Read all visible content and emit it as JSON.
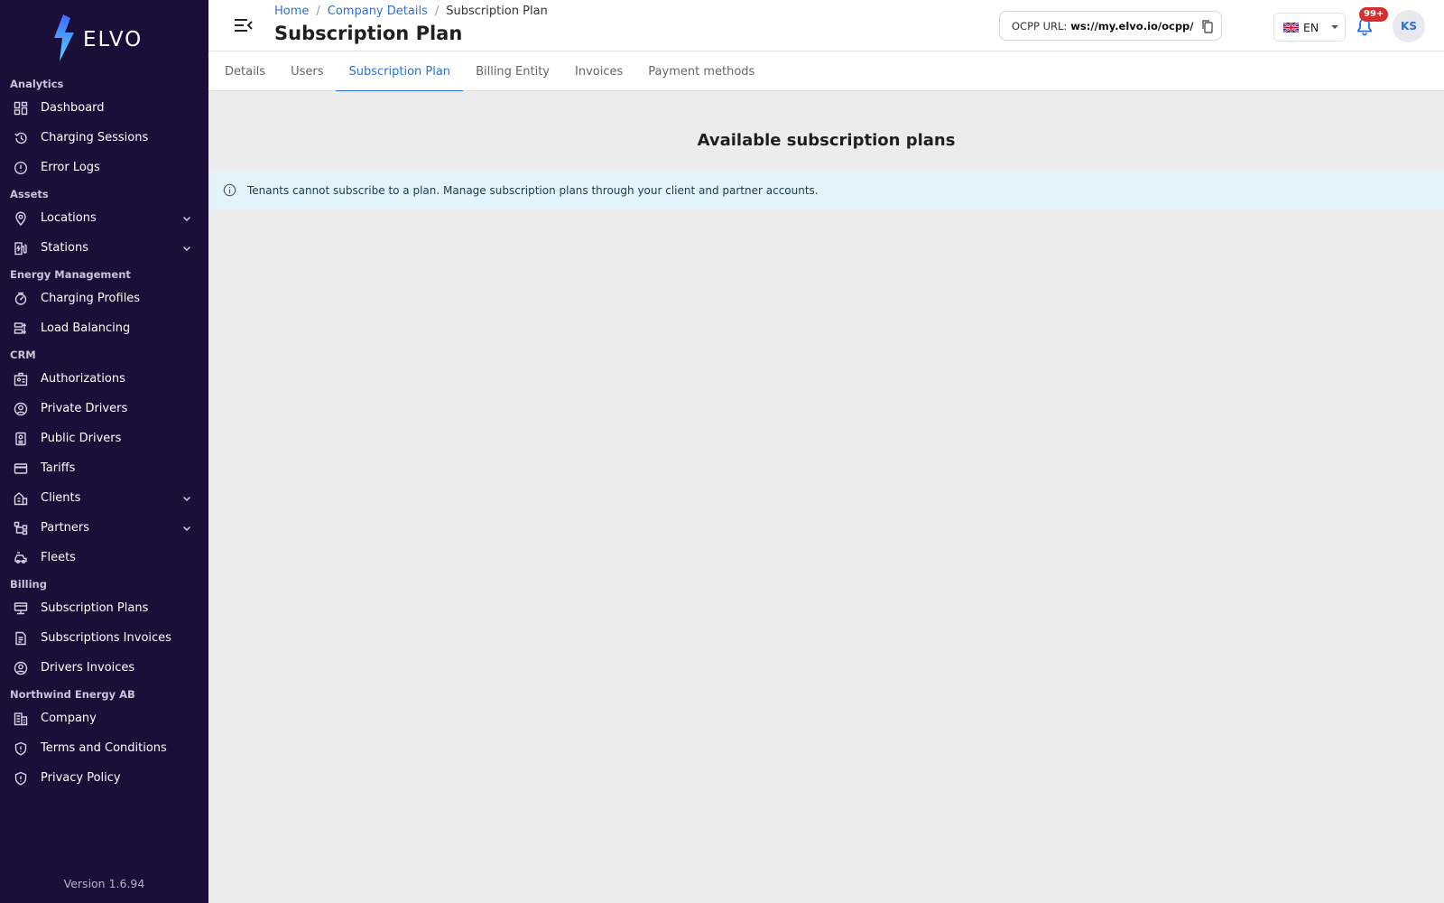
{
  "brand": {
    "name": "ELVO"
  },
  "sidebar": {
    "sections": [
      {
        "title": "Analytics",
        "items": [
          {
            "label": "Dashboard",
            "icon": "dashboard-icon",
            "expandable": false
          },
          {
            "label": "Charging Sessions",
            "icon": "history-icon",
            "expandable": false
          },
          {
            "label": "Error Logs",
            "icon": "error-icon",
            "expandable": false
          }
        ]
      },
      {
        "title": "Assets",
        "items": [
          {
            "label": "Locations",
            "icon": "location-pin-icon",
            "expandable": true
          },
          {
            "label": "Stations",
            "icon": "ev-station-icon",
            "expandable": true
          }
        ]
      },
      {
        "title": "Energy Management",
        "items": [
          {
            "label": "Charging Profiles",
            "icon": "profiles-icon",
            "expandable": false
          },
          {
            "label": "Load Balancing",
            "icon": "load-balancing-icon",
            "expandable": false
          }
        ]
      },
      {
        "title": "CRM",
        "items": [
          {
            "label": "Authorizations",
            "icon": "badge-icon",
            "expandable": false
          },
          {
            "label": "Private Drivers",
            "icon": "user-circle-icon",
            "expandable": false
          },
          {
            "label": "Public Drivers",
            "icon": "id-card-icon",
            "expandable": false
          },
          {
            "label": "Tariffs",
            "icon": "credit-card-icon",
            "expandable": false
          },
          {
            "label": "Clients",
            "icon": "building-icon",
            "expandable": true
          },
          {
            "label": "Partners",
            "icon": "hierarchy-icon",
            "expandable": true
          },
          {
            "label": "Fleets",
            "icon": "car-icon",
            "expandable": false
          }
        ]
      },
      {
        "title": "Billing",
        "items": [
          {
            "label": "Subscription Plans",
            "icon": "plans-icon",
            "expandable": false
          },
          {
            "label": "Subscriptions Invoices",
            "icon": "document-icon",
            "expandable": false
          },
          {
            "label": "Drivers Invoices",
            "icon": "user-circle-icon",
            "expandable": false
          }
        ]
      },
      {
        "title": "Northwind Energy AB",
        "items": [
          {
            "label": "Company",
            "icon": "company-icon",
            "expandable": false
          },
          {
            "label": "Terms and Conditions",
            "icon": "shield-icon",
            "expandable": false
          },
          {
            "label": "Privacy Policy",
            "icon": "shield-icon",
            "expandable": false
          }
        ]
      }
    ],
    "version": "Version 1.6.94"
  },
  "header": {
    "breadcrumb": [
      "Home",
      "Company Details",
      "Subscription Plan"
    ],
    "title": "Subscription Plan",
    "ocpp_label": "OCPP URL:",
    "ocpp_value": "ws://my.elvo.io/ocpp/",
    "language": "EN",
    "notifications_badge": "99+",
    "avatar_initials": "KS"
  },
  "tabs": [
    {
      "label": "Details",
      "active": false
    },
    {
      "label": "Users",
      "active": false
    },
    {
      "label": "Subscription Plan",
      "active": true
    },
    {
      "label": "Billing Entity",
      "active": false
    },
    {
      "label": "Invoices",
      "active": false
    },
    {
      "label": "Payment methods",
      "active": false
    }
  ],
  "main": {
    "title": "Available subscription plans",
    "info_message": "Tenants cannot subscribe to a plan. Manage subscription plans through your client and partner accounts."
  },
  "colors": {
    "sidebar_bg": "#1b0e38",
    "accent": "#2b6fd6",
    "info_bg": "#e3f3fa",
    "badge": "#d32f2f"
  }
}
